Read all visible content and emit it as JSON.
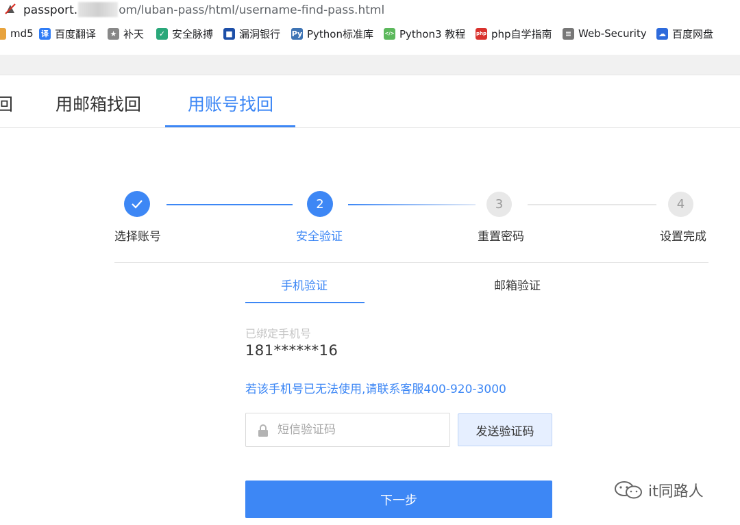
{
  "browser": {
    "url_prefix": "passport.",
    "url_suffix": "om/luban-pass/html/username-find-pass.html"
  },
  "bookmarks": [
    {
      "label": "md5",
      "icon": "bookmark-icon",
      "color": "#e8a33d"
    },
    {
      "label": "百度翻译",
      "icon": "translate-icon",
      "color": "#2f7cf6"
    },
    {
      "label": "补天",
      "icon": "star-icon",
      "color": "#888888"
    },
    {
      "label": "安全脉搏",
      "icon": "shield-icon",
      "color": "#2aa87a"
    },
    {
      "label": "漏洞银行",
      "icon": "bank-icon",
      "color": "#1d4fa8"
    },
    {
      "label": "Python标准库",
      "icon": "python-icon",
      "color": "#3e74b4"
    },
    {
      "label": "Python3 教程",
      "icon": "code-icon",
      "color": "#5cb85c"
    },
    {
      "label": "php自学指南",
      "icon": "php-icon",
      "color": "#d9322d"
    },
    {
      "label": "Web-Security",
      "icon": "doc-icon",
      "color": "#777777"
    },
    {
      "label": "百度网盘",
      "icon": "cloud-icon",
      "color": "#2e6bdc"
    }
  ],
  "tabs": {
    "partial": "回",
    "email": "用邮箱找回",
    "account": "用账号找回"
  },
  "steps": [
    {
      "label": "选择账号",
      "number": "",
      "state": "done"
    },
    {
      "label": "安全验证",
      "number": "2",
      "state": "current"
    },
    {
      "label": "重置密码",
      "number": "3",
      "state": "todo"
    },
    {
      "label": "设置完成",
      "number": "4",
      "state": "todo"
    }
  ],
  "verify": {
    "phone_tab": "手机验证",
    "email_tab": "邮箱验证",
    "bound_label": "已绑定手机号",
    "bound_phone": "181******16",
    "contact_text": "若该手机号已无法使用,请联系客服400-920-3000",
    "code_placeholder": "短信验证码",
    "send_code": "发送验证码",
    "next": "下一步"
  },
  "watermark": "it同路人",
  "colors": {
    "accent": "#3d87f5"
  }
}
